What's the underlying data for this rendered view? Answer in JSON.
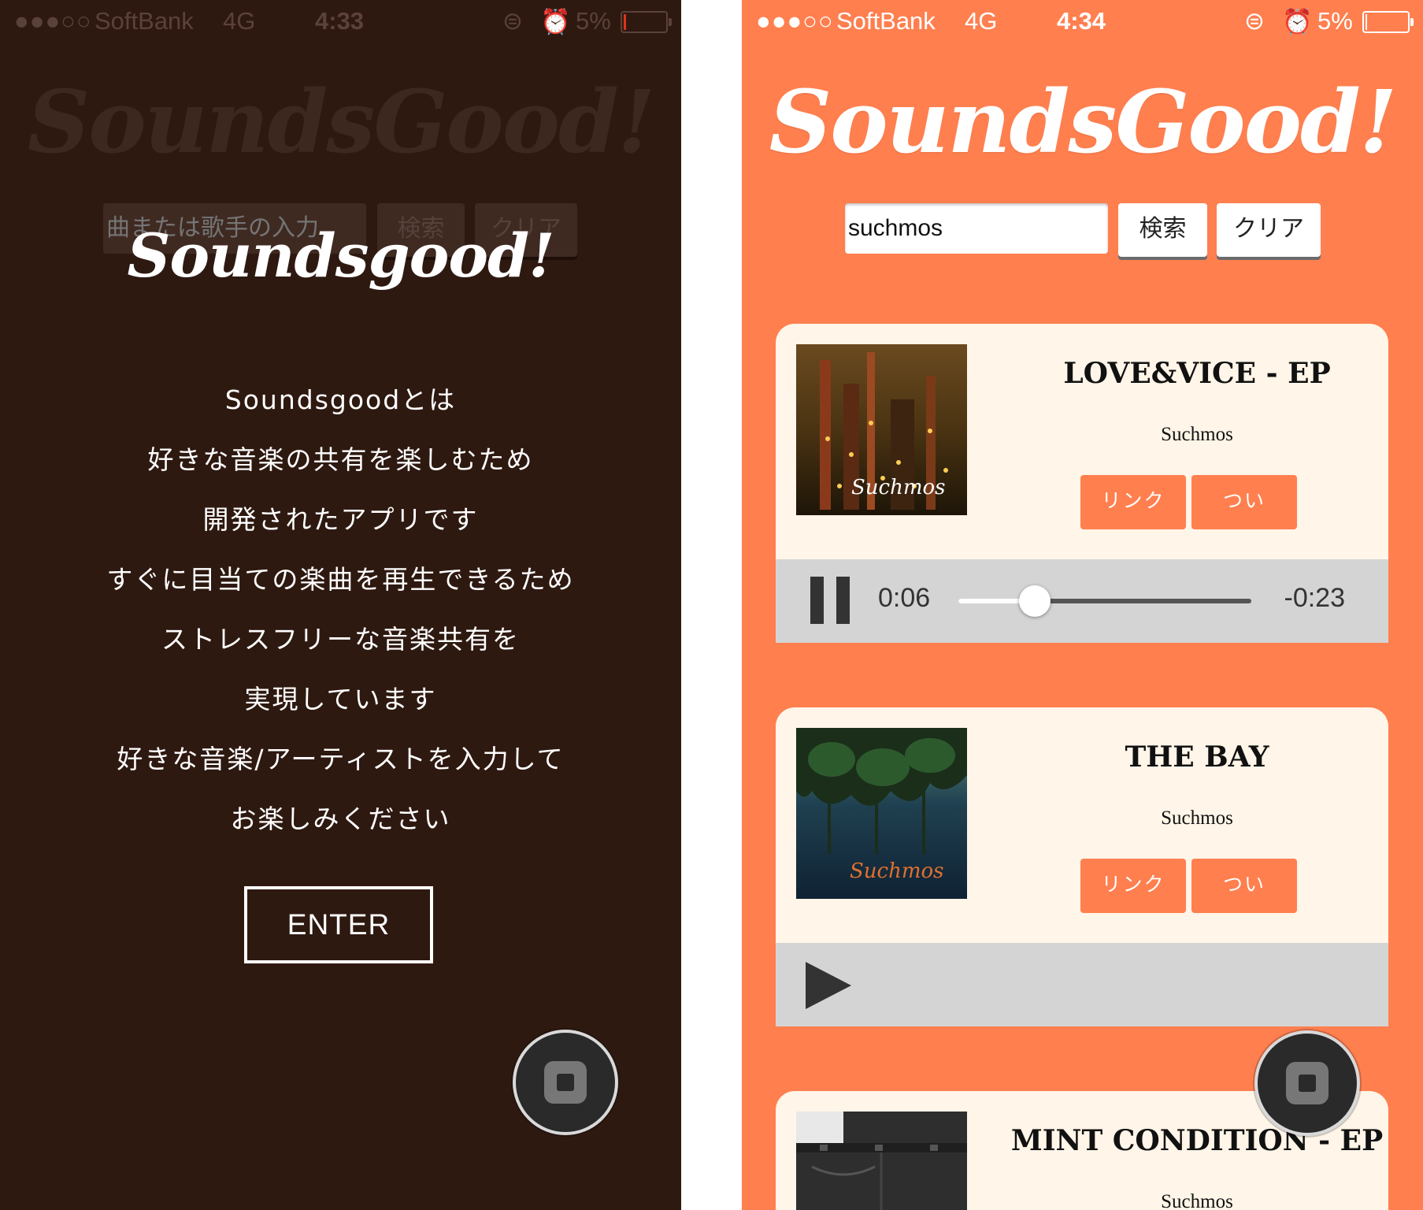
{
  "left_screen": {
    "status": {
      "signal": "●●●○○",
      "carrier": "SoftBank",
      "network": "4G",
      "time": "4:33",
      "lock": "⊜",
      "alarm": "⏰",
      "battery": "5%"
    },
    "logo": "SoundsGood!",
    "search": {
      "placeholder": "曲または歌手の入力",
      "search_label": "検索",
      "clear_label": "クリア"
    },
    "intro": {
      "title": "Soundsgood!",
      "lines": [
        "Soundsgoodとは",
        "好きな音楽の共有を楽しむため",
        "開発されたアプリです",
        "すぐに目当ての楽曲を再生できるため",
        "ストレスフリーな音楽共有を",
        "実現しています",
        "好きな音楽/アーティストを入力して",
        "お楽しみください"
      ],
      "enter_label": "ENTER"
    }
  },
  "right_screen": {
    "status": {
      "signal": "●●●○○",
      "carrier": "SoftBank",
      "network": "4G",
      "time": "4:34",
      "lock": "⊜",
      "alarm": "⏰",
      "battery": "5%"
    },
    "logo": "SoundsGood!",
    "search": {
      "value": "suchmos",
      "search_label": "検索",
      "clear_label": "クリア"
    },
    "results": [
      {
        "title": "LOVE&VICE - EP",
        "artist": "Suchmos",
        "art_label": "Suchmos",
        "link_label": "リンク",
        "tweet_label": "つい",
        "player": {
          "state": "playing",
          "current": "0:06",
          "remaining": "-0:23",
          "progress": 0.26
        }
      },
      {
        "title": "THE BAY",
        "artist": "Suchmos",
        "art_label": "Suchmos",
        "link_label": "リンク",
        "tweet_label": "つい",
        "player": {
          "state": "paused"
        }
      },
      {
        "title": "MINT CONDITION - EP",
        "artist": "Suchmos"
      }
    ]
  },
  "colors": {
    "left_bg": "#2e1911",
    "right_bg": "#ff7f4f",
    "card_bg": "#fff5e8",
    "accent": "#ff7f4f",
    "player_bg": "#d4d4d4"
  }
}
